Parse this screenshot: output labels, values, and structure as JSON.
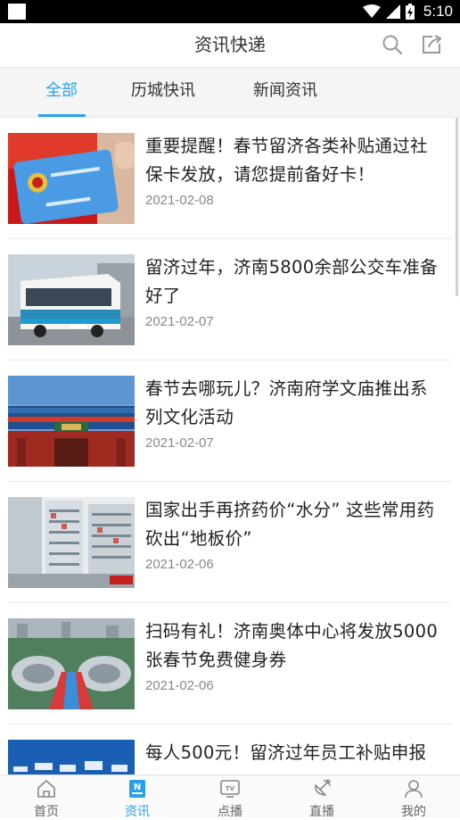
{
  "status_bar": {
    "time": "5:10"
  },
  "header": {
    "title": "资讯快递",
    "search_icon": "search-icon",
    "share_icon": "share-icon"
  },
  "tabs": [
    {
      "label": "全部",
      "active": true
    },
    {
      "label": "历城快讯",
      "active": false
    },
    {
      "label": "新闻资讯",
      "active": false
    }
  ],
  "news": [
    {
      "title": "重要提醒！春节留济各类补贴通过社保卡发放，请您提前备好卡！",
      "date": "2021-02-08",
      "image": "social-security-card"
    },
    {
      "title": "留济过年，济南5800余部公交车准备好了",
      "date": "2021-02-07",
      "image": "city-bus"
    },
    {
      "title": "春节去哪玩儿？济南府学文庙推出系列文化活动",
      "date": "2021-02-07",
      "image": "temple-gate"
    },
    {
      "title": "国家出手再挤药价“水分” 这些常用药砍出“地板价”",
      "date": "2021-02-06",
      "image": "pharmacy-shelves"
    },
    {
      "title": "扫码有礼！济南奥体中心将发放5000张春节免费健身券",
      "date": "2021-02-06",
      "image": "olympic-center-aerial"
    },
    {
      "title": "每人500元！留济过年员工补贴申报",
      "date": "",
      "image": "blue-banner"
    }
  ],
  "bottom_nav": [
    {
      "label": "首页",
      "icon": "home-icon",
      "active": false
    },
    {
      "label": "资讯",
      "icon": "news-icon",
      "active": true
    },
    {
      "label": "点播",
      "icon": "tv-icon",
      "active": false
    },
    {
      "label": "直播",
      "icon": "satellite-icon",
      "active": false
    },
    {
      "label": "我的",
      "icon": "user-icon",
      "active": false
    }
  ],
  "colors": {
    "accent": "#2aa1e6",
    "status_bar": "#000000"
  }
}
